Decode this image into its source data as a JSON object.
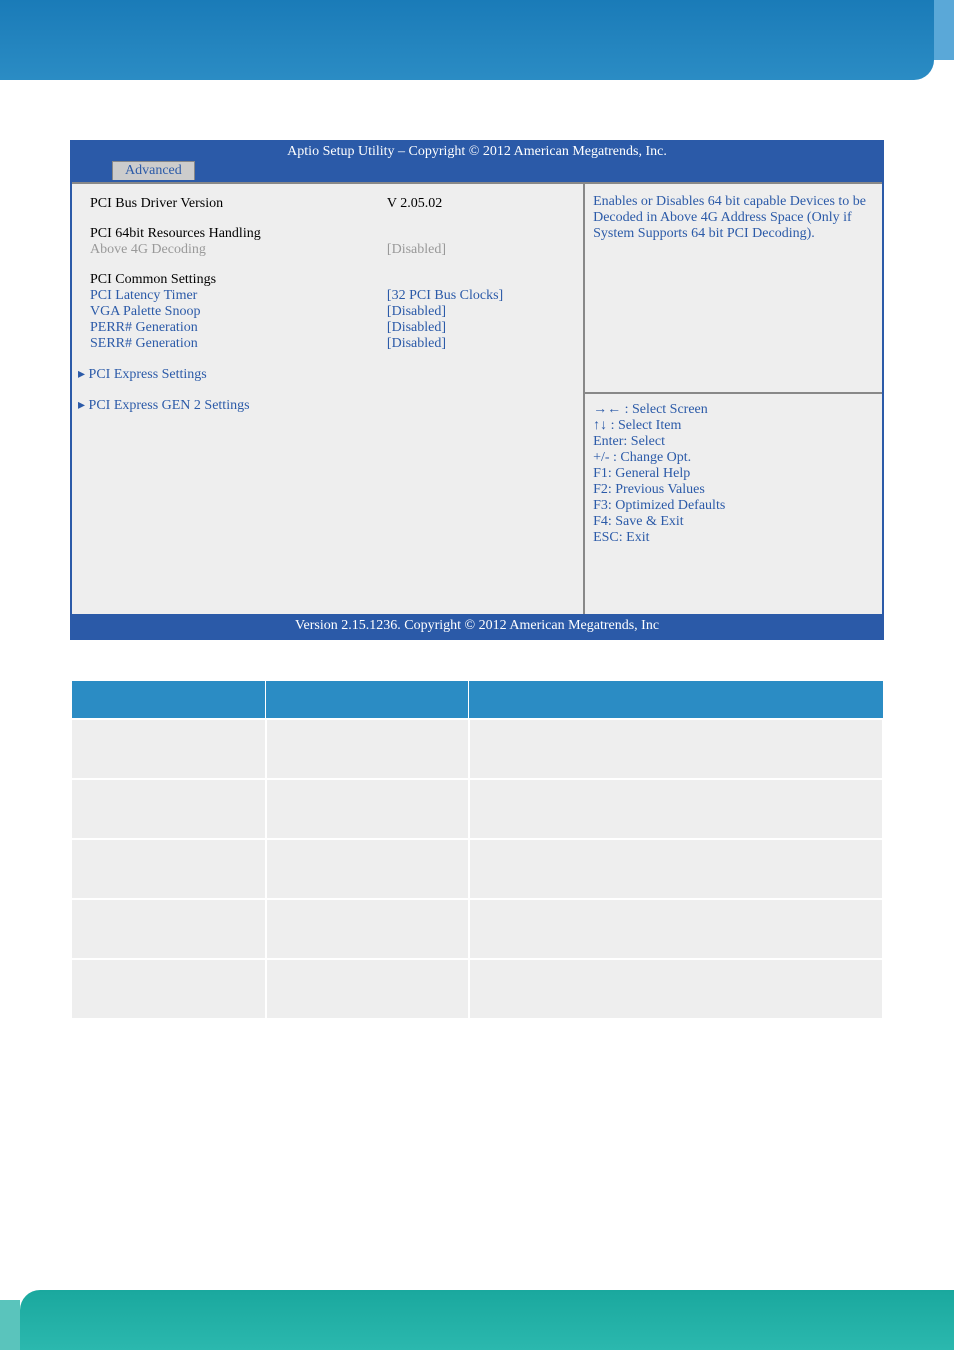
{
  "header": {
    "title": "Aptio Setup Utility  –  Copyright © 2012 American Megatrends, Inc.",
    "tab": "Advanced"
  },
  "left": {
    "driver_label": "PCI Bus Driver Version",
    "driver_value": "V 2.05.02",
    "section1": "PCI 64bit Resources Handling",
    "above4g_label": "Above 4G Decoding",
    "above4g_value": "[Disabled]",
    "section2": "PCI Common Settings",
    "latency_label": "PCI Latency Timer",
    "latency_value": "[32 PCI Bus Clocks]",
    "vga_label": "VGA Palette Snoop",
    "vga_value": "[Disabled]",
    "perr_label": "PERR# Generation",
    "perr_value": "[Disabled]",
    "serr_label": "SERR# Generation",
    "serr_value": "[Disabled]",
    "submenu1": "PCI Express Settings",
    "submenu2": "PCI Express GEN 2 Settings"
  },
  "help": {
    "text": "Enables or Disables 64 bit capable Devices to be Decoded in Above 4G Address Space (Only if System Supports 64 bit PCI Decoding).",
    "k1": "→← : Select Screen",
    "k2": "↑↓ : Select Item",
    "k3": "Enter: Select",
    "k4": "+/- : Change Opt.",
    "k5": "F1: General Help",
    "k6": "F2: Previous Values",
    "k7": "F3: Optimized Defaults",
    "k8": "F4: Save & Exit",
    "k9": "ESC: Exit"
  },
  "footer": "Version 2.15.1236. Copyright © 2012 American Megatrends, Inc"
}
